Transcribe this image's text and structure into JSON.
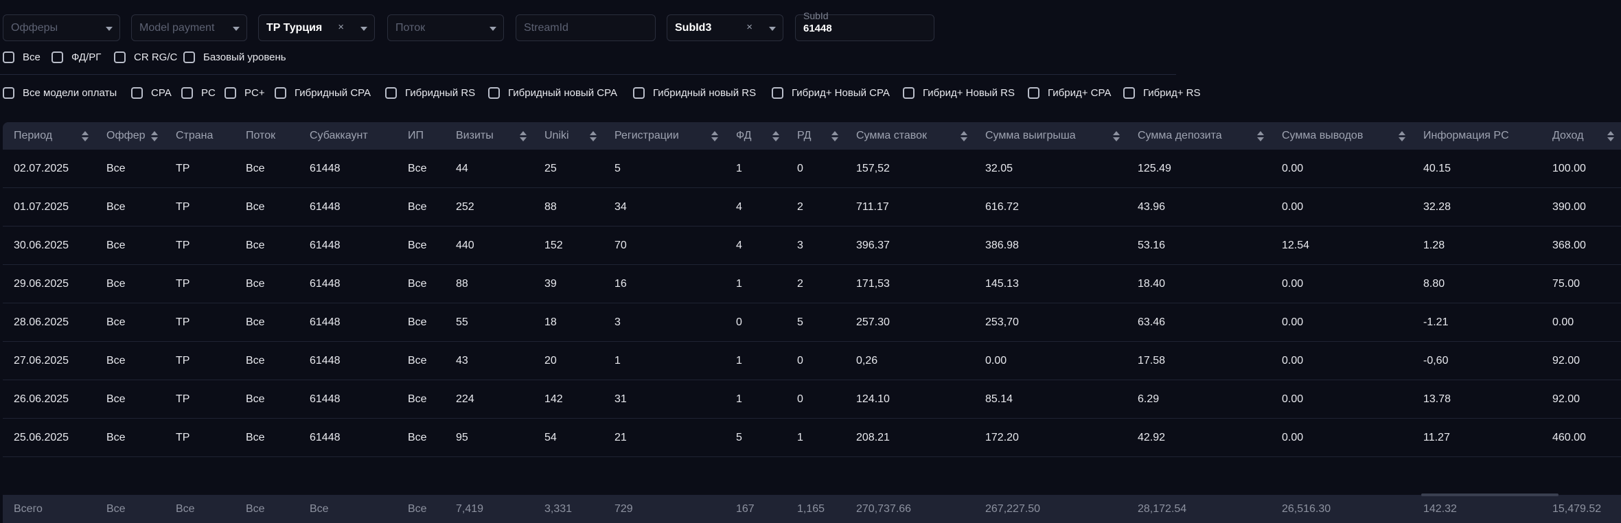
{
  "filters": {
    "offers_placeholder": "Офферы",
    "model_payment_placeholder": "Model payment",
    "country_value": "TP Турция",
    "stream_placeholder": "Поток",
    "streamid_placeholder": "StreamId",
    "subid_key_value": "SubId3",
    "subid_label": "SubId",
    "subid_value": "61448",
    "clear_symbol": "×"
  },
  "level_checkboxes": [
    "Все",
    "ФД/РГ",
    "CR RG/C",
    "Базовый уровень"
  ],
  "payment_checkboxes": [
    "Все модели оплаты",
    "CPA",
    "PC",
    "PC+",
    "Гибридный CPA",
    "Гибридный RS",
    "Гибридный новый CPA",
    "Гибридный новый RS",
    "Гибрид+ Новый CPA",
    "Гибрид+ Новый RS",
    "Гибрид+ CPA",
    "Гибрид+ RS"
  ],
  "table": {
    "headers": [
      "Период",
      "Оффер",
      "Страна",
      "Поток",
      "Субаккаунт",
      "ИП",
      "Визиты",
      "Uniki",
      "Регистрации",
      "ФД",
      "РД",
      "Сумма ставок",
      "Сумма выигрыша",
      "Сумма депозита",
      "Сумма выводов",
      "Информация PC",
      "Доход"
    ],
    "rows": [
      [
        "02.07.2025",
        "Все",
        "TP",
        "Все",
        "61448",
        "Все",
        "44",
        "25",
        "5",
        "1",
        "0",
        "157,52",
        "32.05",
        "125.49",
        "0.00",
        "40.15",
        "100.00"
      ],
      [
        "01.07.2025",
        "Все",
        "TP",
        "Все",
        "61448",
        "Все",
        "252",
        "88",
        "34",
        "4",
        "2",
        "711.17",
        "616.72",
        "43.96",
        "0.00",
        "32.28",
        "390.00"
      ],
      [
        "30.06.2025",
        "Все",
        "TP",
        "Все",
        "61448",
        "Все",
        "440",
        "152",
        "70",
        "4",
        "3",
        "396.37",
        "386.98",
        "53.16",
        "12.54",
        "1.28",
        "368.00"
      ],
      [
        "29.06.2025",
        "Все",
        "TP",
        "Все",
        "61448",
        "Все",
        "88",
        "39",
        "16",
        "1",
        "2",
        "171,53",
        "145.13",
        "18.40",
        "0.00",
        "8.80",
        "75.00"
      ],
      [
        "28.06.2025",
        "Все",
        "TP",
        "Все",
        "61448",
        "Все",
        "55",
        "18",
        "3",
        "0",
        "5",
        "257.30",
        "253,70",
        "63.46",
        "0.00",
        "-1.21",
        "0.00"
      ],
      [
        "27.06.2025",
        "Все",
        "TP",
        "Все",
        "61448",
        "Все",
        "43",
        "20",
        "1",
        "1",
        "0",
        "0,26",
        "0.00",
        "17.58",
        "0.00",
        "-0,60",
        "92.00"
      ],
      [
        "26.06.2025",
        "Все",
        "TP",
        "Все",
        "61448",
        "Все",
        "224",
        "142",
        "31",
        "1",
        "0",
        "124.10",
        "85.14",
        "6.29",
        "0.00",
        "13.78",
        "92.00"
      ],
      [
        "25.06.2025",
        "Все",
        "TP",
        "Все",
        "61448",
        "Все",
        "95",
        "54",
        "21",
        "5",
        "1",
        "208.21",
        "172.20",
        "42.92",
        "0.00",
        "11.27",
        "460.00"
      ]
    ],
    "total": [
      "Всего",
      "Все",
      "Все",
      "Все",
      "Все",
      "Все",
      "7,419",
      "3,331",
      "729",
      "167",
      "1,165",
      "270,737.66",
      "267,227.50",
      "28,172.54",
      "26,516.30",
      "142.32",
      "15,479.52"
    ]
  },
  "colors": {
    "background": "#0b0d17",
    "header_bg": "#1f2333",
    "border": "#2a2e3c"
  }
}
